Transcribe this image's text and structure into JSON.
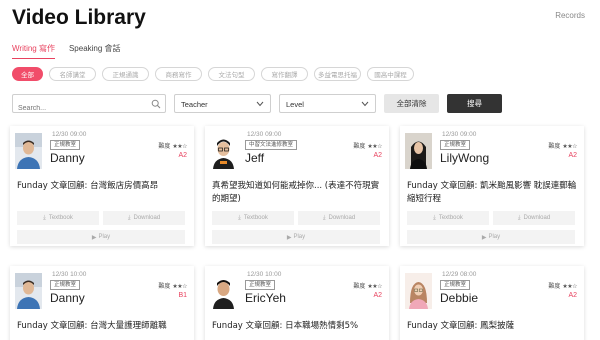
{
  "header": {
    "title": "Video Library",
    "records_label": "Records"
  },
  "tabs": [
    {
      "label": "Writing 寫作",
      "active": true
    },
    {
      "label": "Speaking 會話",
      "active": false
    }
  ],
  "categories": [
    "全部",
    "名師講堂",
    "正規通識",
    "商務寫作",
    "文法句型",
    "寫作翻譯",
    "多益電思托福",
    "國高中課程"
  ],
  "filters": {
    "search_placeholder": "Search...",
    "teacher_label": "Teacher",
    "level_label": "Level",
    "clear_label": "全部清除",
    "search_label": "搜尋"
  },
  "colors": {
    "accent": "#e8415e",
    "dark_button": "#333333"
  },
  "card_labels": {
    "difficulty": "難度",
    "textbook": "Textbook",
    "download": "Download",
    "play": "Play"
  },
  "cards": [
    {
      "time": "12/30 09:00",
      "badge": "正規教室",
      "teacher": "Danny",
      "difficulty_stars": "★★☆",
      "level": "A2",
      "title": "Funday 文章回顧: 台灣飯店房價高昂",
      "avatar": "man-blue-shirt"
    },
    {
      "time": "12/30 09:00",
      "badge": "中習文法進修教室",
      "teacher": "Jeff",
      "difficulty_stars": "★★☆",
      "level": "A2",
      "title": "真希望我知道如何能戒掉你... (表達不符現實的期望)",
      "avatar": "man-glasses"
    },
    {
      "time": "12/30 09:00",
      "badge": "正規教室",
      "teacher": "LilyWong",
      "difficulty_stars": "★★☆",
      "level": "A2",
      "title": "Funday 文章回顧: 凱米颱風影響 耽誤連郵輪縮短行程",
      "avatar": "woman-dark-hair"
    },
    {
      "time": "12/30 10:00",
      "badge": "正規教室",
      "teacher": "Danny",
      "difficulty_stars": "★★☆",
      "level": "B1",
      "title": "Funday 文章回顧: 台灣大量護理師離職",
      "avatar": "man-blue-shirt"
    },
    {
      "time": "12/30 10:00",
      "badge": "正規教室",
      "teacher": "EricYeh",
      "difficulty_stars": "★★☆",
      "level": "A2",
      "title": "Funday 文章回顧: 日本職場熱情剩5%",
      "avatar": "man-dark"
    },
    {
      "time": "12/29 08:00",
      "badge": "正規教室",
      "teacher": "Debbie",
      "difficulty_stars": "★★☆",
      "level": "A2",
      "title": "Funday 文章回顧: 鳳梨披薩",
      "avatar": "woman-light"
    }
  ]
}
